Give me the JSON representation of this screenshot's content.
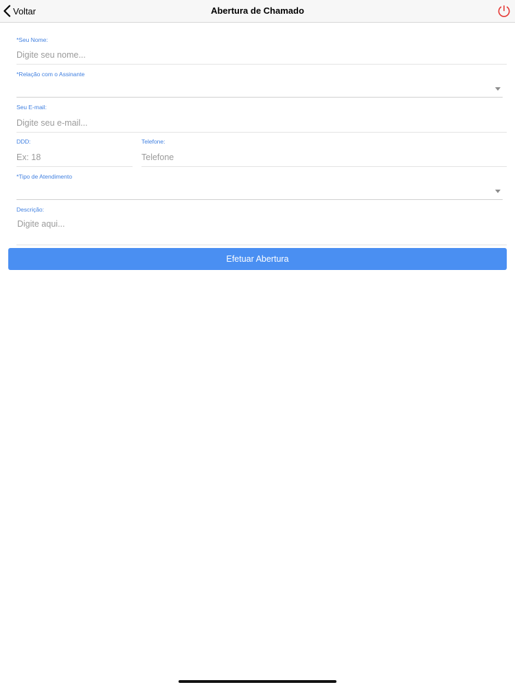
{
  "navbar": {
    "back_label": "Voltar",
    "title": "Abertura de Chamado",
    "power_icon": "power-icon",
    "power_color": "#e53935"
  },
  "form": {
    "nome": {
      "label": "*Seu Nome:",
      "placeholder": "Digite seu nome...",
      "value": ""
    },
    "relacao": {
      "label": "*Relação com o Assinante",
      "value": ""
    },
    "email": {
      "label": "Seu E-mail:",
      "placeholder": "Digite seu e-mail...",
      "value": ""
    },
    "ddd": {
      "label": "DDD:",
      "placeholder": "Ex: 18",
      "value": ""
    },
    "telefone": {
      "label": "Telefone:",
      "placeholder": "Telefone",
      "value": ""
    },
    "tipo": {
      "label": "*Tipo de Atendimento",
      "value": ""
    },
    "descricao": {
      "label": "Descrição:",
      "placeholder": "Digite aqui...",
      "value": ""
    }
  },
  "submit": {
    "label": "Efetuar Abertura"
  },
  "colors": {
    "accent": "#4a8ff2",
    "label": "#3f7fe0"
  }
}
